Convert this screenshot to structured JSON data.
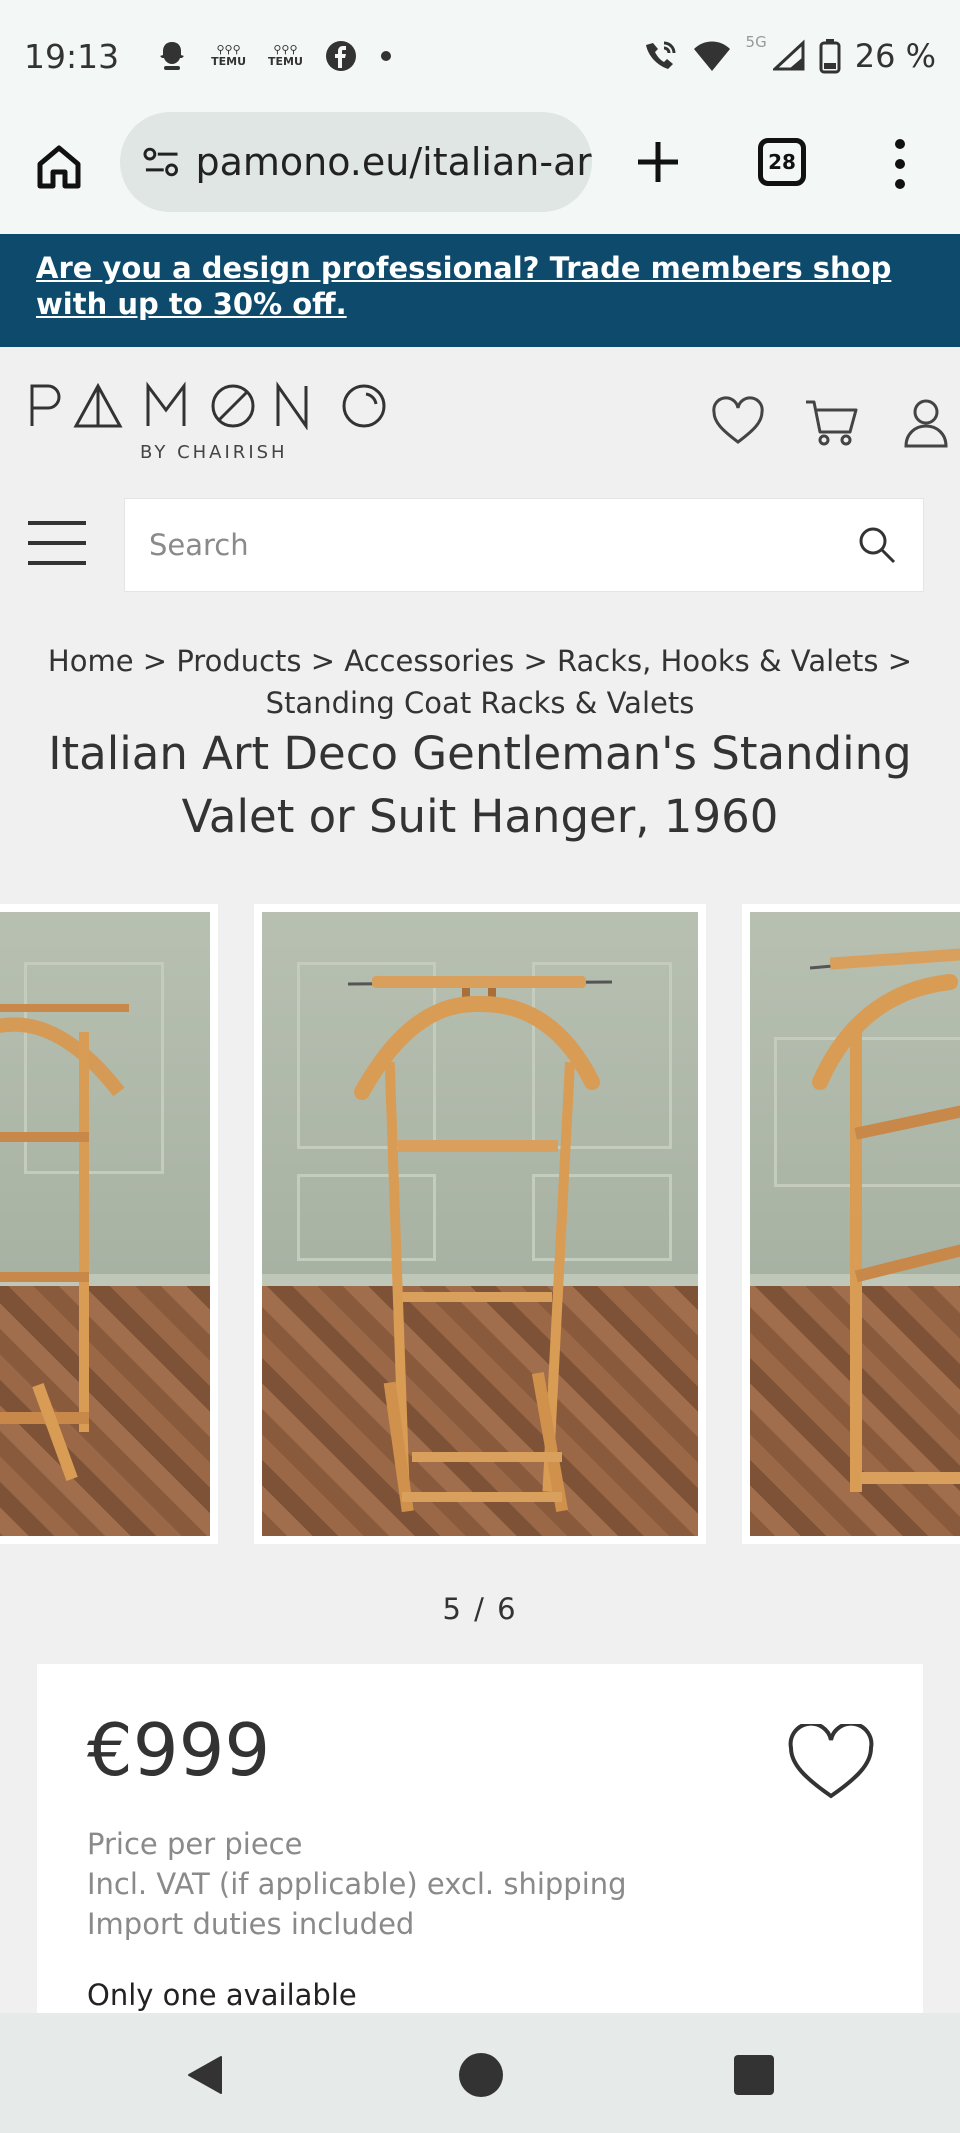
{
  "status_bar": {
    "time": "19:13",
    "temu_label": "TEMU",
    "battery": "26 %",
    "network_label": "5G",
    "icons": [
      "snapchat-icon",
      "temu-icon",
      "temu-icon",
      "facebook-icon",
      "dot-icon",
      "wifi-call-icon",
      "wifi-icon",
      "signal-icon",
      "battery-icon"
    ]
  },
  "browser": {
    "url": "pamono.eu/italian-ar",
    "tab_count": "28"
  },
  "trade_banner": {
    "text": "Are you a design professional? Trade members shop with up to 30% off."
  },
  "header": {
    "logo_text": "PAMONO",
    "logo_sub": "BY CHAIRISH"
  },
  "search": {
    "placeholder": "Search"
  },
  "breadcrumb": {
    "items": [
      "Home",
      "Products",
      "Accessories",
      "Racks, Hooks & Valets",
      "Standing Coat Racks & Valets"
    ],
    "separator": ">"
  },
  "product": {
    "title": "Italian Art Deco Gentleman's Standing Valet or Suit Hanger, 1960",
    "pager": "5 / 6",
    "price": "€999",
    "price_notes": [
      "Price per piece",
      "Incl. VAT (if applicable) excl. shipping",
      "Import duties included"
    ],
    "availability": "Only one available"
  },
  "colors": {
    "banner_bg": "#0d4a6b",
    "page_bg": "#f0f0f0",
    "browser_bg": "#f3f8f6"
  }
}
